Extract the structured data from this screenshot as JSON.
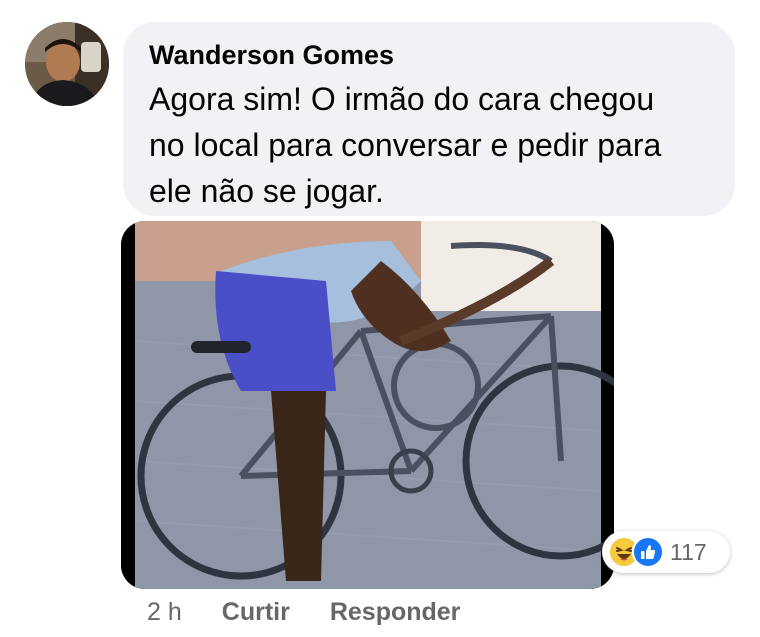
{
  "comment": {
    "author": "Wanderson Gomes",
    "text_lines": [
      "Agora sim! O irmão do cara chegou",
      "no local para conversar e pedir para",
      "ele não se jogar."
    ],
    "time": "2 h",
    "like_label": "Curtir",
    "reply_label": "Responder",
    "reactions": {
      "icons": [
        "haha-icon",
        "like-icon"
      ],
      "count": "117"
    }
  },
  "colors": {
    "bubble_bg": "#f0f2f5",
    "meta_text": "#65676b",
    "like_blue": "#1877f2",
    "haha_yellow": "#f7c93f"
  }
}
